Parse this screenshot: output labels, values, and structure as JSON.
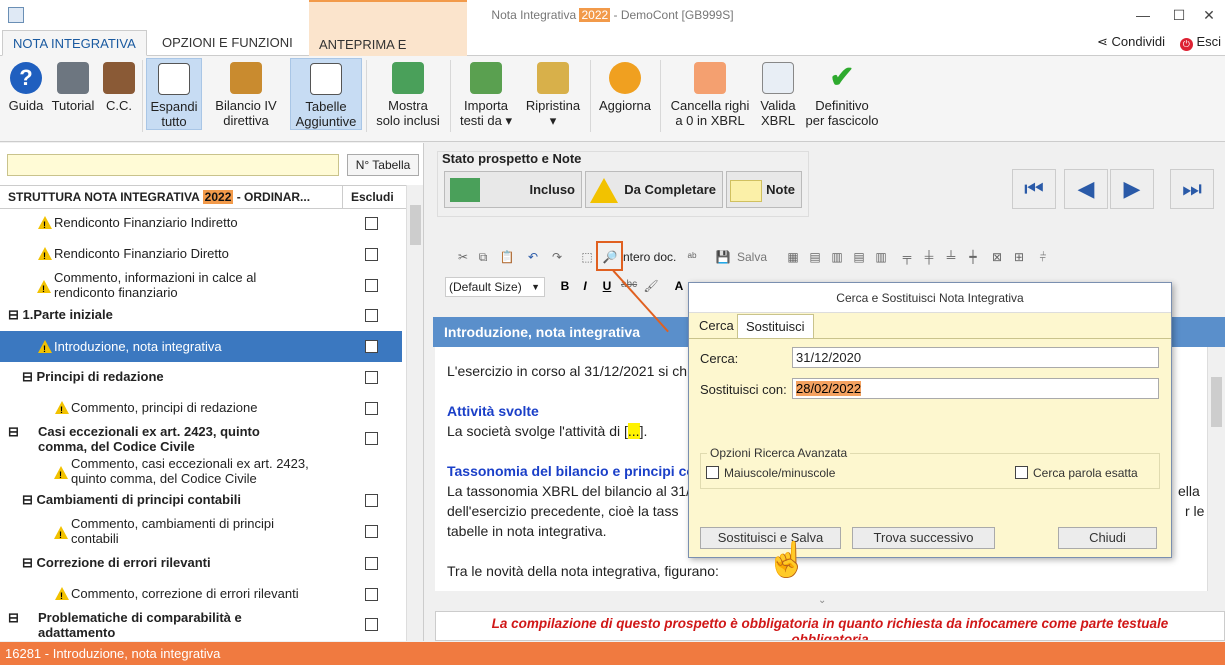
{
  "window": {
    "title_prefix": "Nota Integrativa",
    "title_year": "2022",
    "title_suffix": "- DemoCont [GB999S]",
    "controls": {
      "minimize": "—",
      "maximize": "☐",
      "close": "✕"
    }
  },
  "ribbon_tabs": [
    "NOTA INTEGRATIVA",
    "OPZIONI E FUNZIONI",
    "ANTEPRIMA E STAMPA"
  ],
  "share_label": "Condividi",
  "exit_label": "Esci",
  "ribbon_buttons": {
    "guida": "Guida",
    "tutorial": "Tutorial",
    "cc": "C.C.",
    "espandi_1": "Espandi",
    "espandi_2": "tutto",
    "bilancio_1": "Bilancio IV",
    "bilancio_2": "direttiva",
    "tabelle_1": "Tabelle",
    "tabelle_2": "Aggiuntive",
    "mostra_1": "Mostra",
    "mostra_2": "solo inclusi",
    "importa_1": "Importa",
    "importa_2": "testi da ▾",
    "ripristina_1": "Ripristina",
    "ripristina_2": "▾",
    "aggiorna": "Aggiorna",
    "cancella_1": "Cancella righi",
    "cancella_2": "a 0 in XBRL",
    "valida_1": "Valida",
    "valida_2": "XBRL",
    "definitivo_1": "Definitivo",
    "definitivo_2": "per fascicolo"
  },
  "left_pane": {
    "search_value": "",
    "ntab_button": "N° Tabella",
    "header_prefix": "STRUTTURA NOTA INTEGRATIVA",
    "header_year": "2022",
    "header_suffix": "- ORDINAR...",
    "exclude_header": "Escludi",
    "tree_items": [
      {
        "label": "Rendiconto Finanziario Indiretto"
      },
      {
        "label": "Rendiconto Finanziario Diretto"
      },
      {
        "label": "Commento, informazioni in calce al rendiconto finanziario"
      },
      {
        "label": "1.Parte iniziale"
      },
      {
        "label": "Introduzione, nota integrativa"
      },
      {
        "label": "Principi di redazione"
      },
      {
        "label": "Commento, principi di redazione"
      },
      {
        "label": "Casi eccezionali ex art. 2423, quinto comma, del Codice Civile"
      },
      {
        "label": "Commento, casi eccezionali ex art. 2423, quinto comma, del Codice Civile"
      },
      {
        "label": "Cambiamenti di principi contabili"
      },
      {
        "label": "Commento, cambiamenti di principi contabili"
      },
      {
        "label": "Correzione di errori rilevanti"
      },
      {
        "label": "Commento, correzione di errori rilevanti"
      },
      {
        "label": "Problematiche di comparabilità e adattamento"
      }
    ]
  },
  "stato": {
    "title": "Stato prospetto e Note",
    "incluso": "Incluso",
    "da_completare": "Da Completare",
    "note": "Note"
  },
  "editor": {
    "intero_doc": "ntero doc.",
    "salva": "Salva",
    "font_size": "(Default Size)"
  },
  "document": {
    "section_title": "Introduzione, nota integrativa",
    "p1": "L'esercizio in corso al 31/12/2021 si ch",
    "h1": "Attività svolte",
    "p2_prefix": "La società svolge l'attività di [",
    "p2_hl": "...",
    "p2_suffix": "].",
    "h2": "Tassonomia del bilancio e principi co",
    "p3_l1": "La tassonomia XBRL del bilancio al 31/",
    "p3_l1_end": "ella",
    "p3_l2": "dell'esercizio precedente, cioè la tass",
    "p3_l2_end": "r le",
    "p3_l3": "tabelle in nota integrativa.",
    "p4": "Tra le novità della nota integrativa, figurano:",
    "note_line1": "La compilazione di questo prospetto è obbligatoria in quanto richiesta da infocamere come parte testuale",
    "note_line2": "obbligatoria"
  },
  "dialog": {
    "title": "Cerca e Sostituisci Nota Integrativa",
    "tab_cerca": "Cerca",
    "tab_sostituisci": "Sostituisci",
    "cerca_label": "Cerca:",
    "cerca_value": "31/12/2020",
    "sostituisci_label": "Sostituisci con:",
    "sostituisci_value": "28/02/2022",
    "options_title": "Opzioni Ricerca Avanzata",
    "opt_case": "Maiuscole/minuscole",
    "opt_word": "Cerca parola esatta",
    "btn_replace_save": "Sostituisci e Salva",
    "btn_find_next": "Trova successivo",
    "btn_close": "Chiudi"
  },
  "status_bar": "16281 - Introduzione, nota integrativa",
  "colors": {
    "accent": "#f07a40",
    "selection": "#3b78c0",
    "dialog_bg": "#fdf7cf"
  }
}
